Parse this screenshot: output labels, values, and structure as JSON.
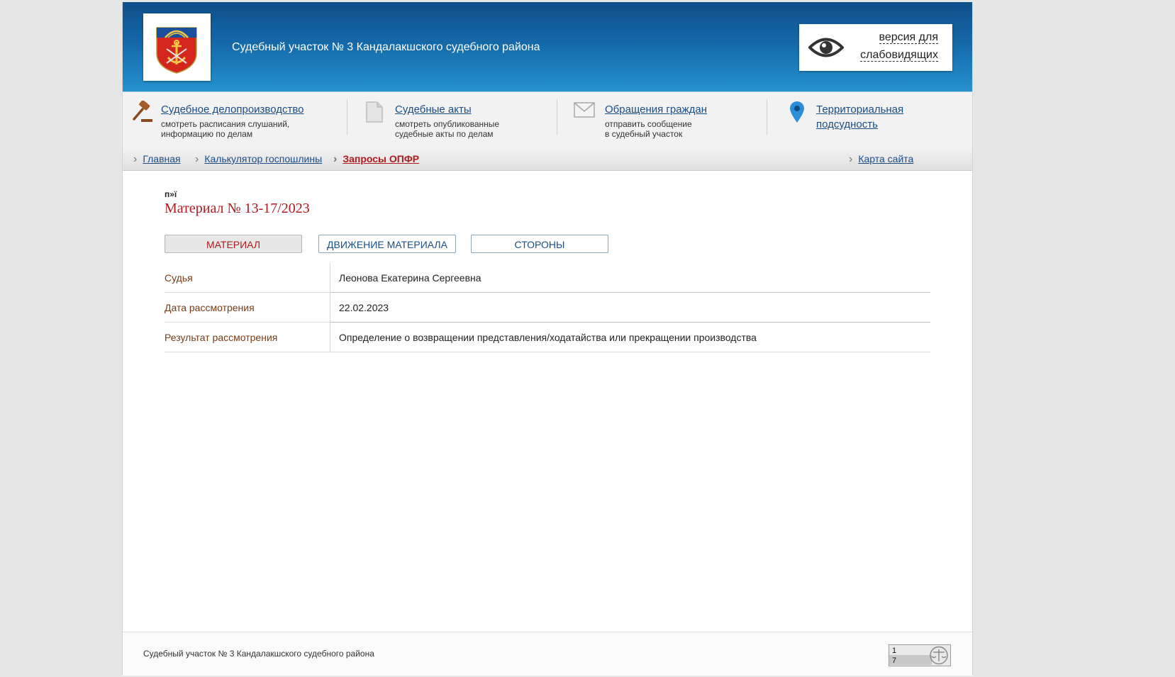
{
  "header": {
    "site_title": "Судебный участок № 3 Кандалакшского судебного района",
    "accessibility_line1": "версия для",
    "accessibility_line2": "слабовидящих"
  },
  "services": [
    {
      "link": "Судебное делопроизводство",
      "desc1": "смотреть расписания слушаний,",
      "desc2": "информацию по делам",
      "icon": "gavel-icon"
    },
    {
      "link": "Судебные акты",
      "desc1": "смотреть опубликованные",
      "desc2": "судебные акты по делам",
      "icon": "document-icon"
    },
    {
      "link": "Обращения граждан",
      "desc1": "отправить сообщение",
      "desc2": "в судебный участок",
      "icon": "envelope-icon"
    },
    {
      "link1": "Территориальная",
      "link2": "подсудность",
      "icon": "map-pin-icon"
    }
  ],
  "breadcrumb": {
    "items": [
      "Главная",
      "Калькулятор госпошлины",
      "Запросы ОПФР"
    ],
    "sitemap": "Карта сайта"
  },
  "content": {
    "mark": "п»ї",
    "title": "Материал № 13-17/2023",
    "tabs": [
      "МАТЕРИАЛ",
      "ДВИЖЕНИЕ МАТЕРИАЛА",
      "СТОРОНЫ"
    ],
    "rows": [
      {
        "label": "Судья",
        "value": "Леонова Екатерина Сергеевна"
      },
      {
        "label": "Дата рассмотрения",
        "value": "22.02.2023"
      },
      {
        "label": "Результат рассмотрения",
        "value": "Определение о возвращении представления/ходатайства или прекращении производства"
      }
    ]
  },
  "footer": {
    "text": "Судебный участок № 3 Кандалакшского судебного района",
    "counter_top": "1",
    "counter_bottom": "7"
  },
  "colors": {
    "accent_red": "#b0191e",
    "link_blue": "#1a4d86",
    "header_blue": "#1568a8"
  }
}
